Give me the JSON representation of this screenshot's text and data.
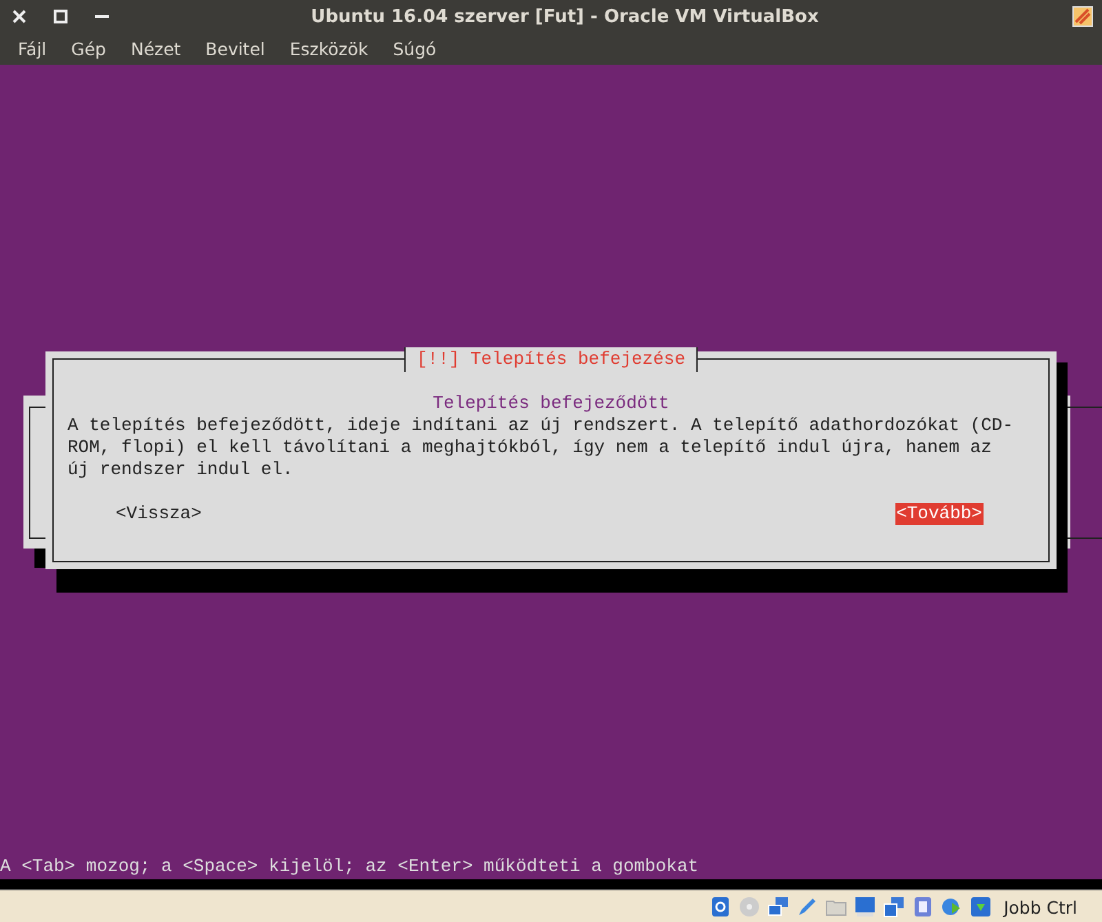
{
  "window": {
    "title": "Ubuntu 16.04 szerver [Fut] - Oracle VM VirtualBox"
  },
  "menu": [
    "Fájl",
    "Gép",
    "Nézet",
    "Bevitel",
    "Eszközök",
    "Súgó"
  ],
  "dialog": {
    "title": "[!!] Telepítés befejezése",
    "heading": "Telepítés befejeződött",
    "message": "A telepítés befejeződött, ideje indítani az új rendszert. A telepítő adathordozókat (CD-ROM, flopi) el kell távolítani a meghajtókból, így nem a telepítő indul újra, hanem az új rendszer indul el.",
    "buttons": [
      {
        "label": "<Vissza>",
        "selected": false
      },
      {
        "label": "<Tovább>",
        "selected": true
      }
    ]
  },
  "console_hint": "A <Tab> mozog; a <Space> kijelöl; az <Enter> működteti a gombokat",
  "status_bar": {
    "host_key": "Jobb Ctrl"
  }
}
